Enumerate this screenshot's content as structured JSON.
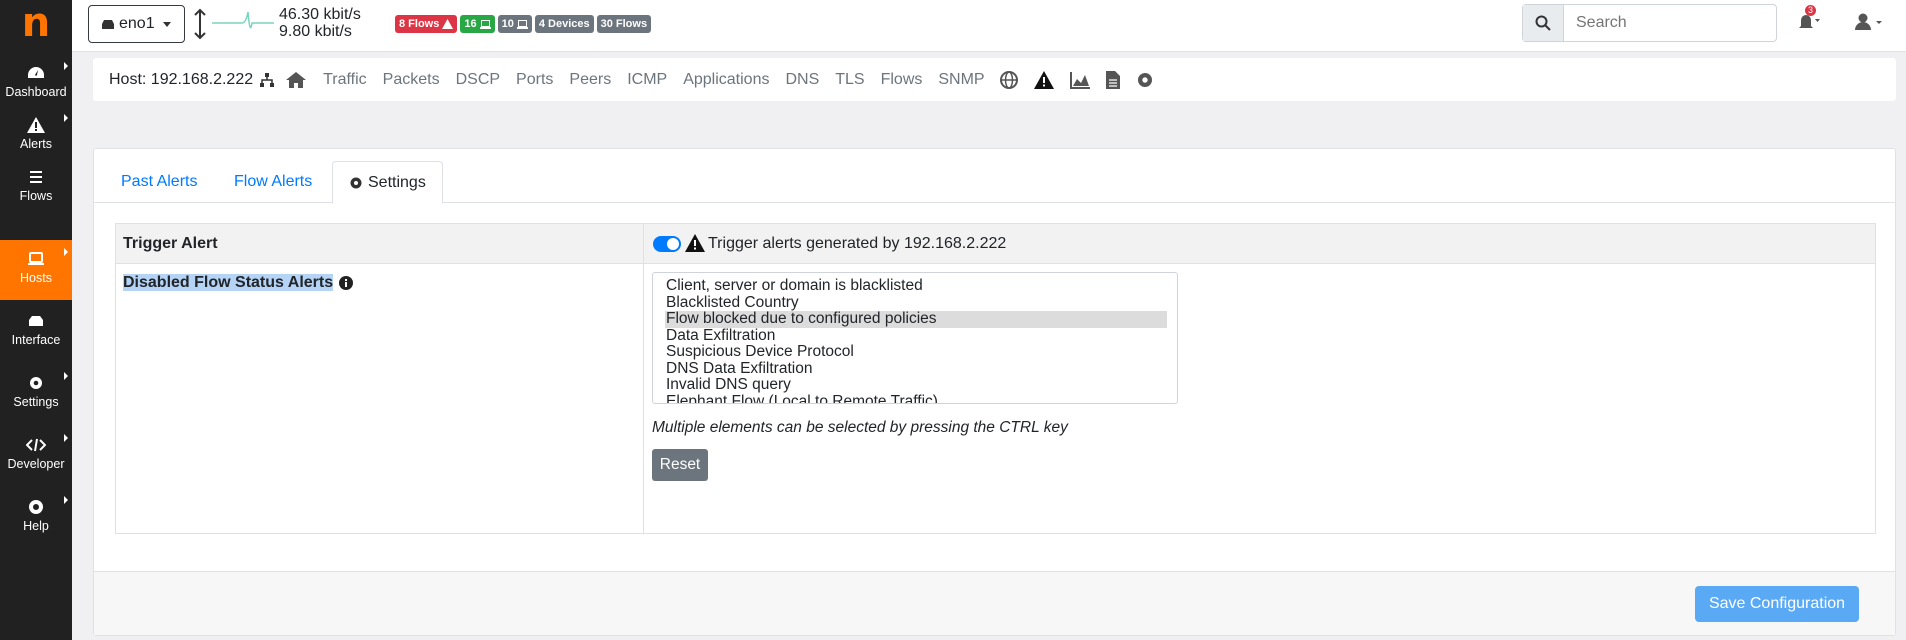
{
  "brand": {
    "logo_letter": "n",
    "accent_color": "#ff7500"
  },
  "sidebar": {
    "items": [
      {
        "label": "Dashboard",
        "icon": "dashboard-icon"
      },
      {
        "label": "Alerts",
        "icon": "warning-icon"
      },
      {
        "label": "Flows",
        "icon": "list-icon"
      },
      {
        "label": "Hosts",
        "icon": "laptop-icon",
        "active": true
      },
      {
        "label": "Interface",
        "icon": "ethernet-icon"
      },
      {
        "label": "Settings",
        "icon": "gear-icon"
      },
      {
        "label": "Developer",
        "icon": "code-icon"
      },
      {
        "label": "Help",
        "icon": "lifering-icon"
      }
    ]
  },
  "topbar": {
    "interface": "eno1",
    "traffic_up": "46.30 kbit/s",
    "traffic_down": "9.80 kbit/s",
    "badges": [
      {
        "text": "8 Flows",
        "color": "red",
        "icon": "warning-icon"
      },
      {
        "text": "16",
        "color": "green",
        "icon": "laptop-icon"
      },
      {
        "text": "10",
        "color": "gray",
        "icon": "laptop-icon"
      },
      {
        "text": "4 Devices",
        "color": "gray"
      },
      {
        "text": "30 Flows",
        "color": "gray"
      }
    ],
    "search_placeholder": "Search",
    "notifications_count": "3"
  },
  "hostbar": {
    "host_label": "Host: 192.168.2.222",
    "links": [
      "Traffic",
      "Packets",
      "DSCP",
      "Ports",
      "Peers",
      "ICMP",
      "Applications",
      "DNS",
      "TLS",
      "Flows",
      "SNMP"
    ]
  },
  "tabs": [
    {
      "label": "Past Alerts"
    },
    {
      "label": "Flow Alerts"
    },
    {
      "label": "Settings",
      "active": true
    }
  ],
  "settings": {
    "trigger_label": "Trigger Alert",
    "trigger_enabled": true,
    "trigger_text": "Trigger alerts generated by 192.168.2.222",
    "disabled_label": "Disabled Flow Status Alerts",
    "options": [
      "Client, server or domain is blacklisted",
      "Blacklisted Country",
      "Flow blocked due to configured policies",
      "Data Exfiltration",
      "Suspicious Device Protocol",
      "DNS Data Exfiltration",
      "Invalid DNS query",
      "Elephant Flow (Local to Remote Traffic)"
    ],
    "selected_option": "Flow blocked due to configured policies",
    "hint": "Multiple elements can be selected by pressing the CTRL key",
    "reset_label": "Reset",
    "save_label": "Save Configuration"
  }
}
